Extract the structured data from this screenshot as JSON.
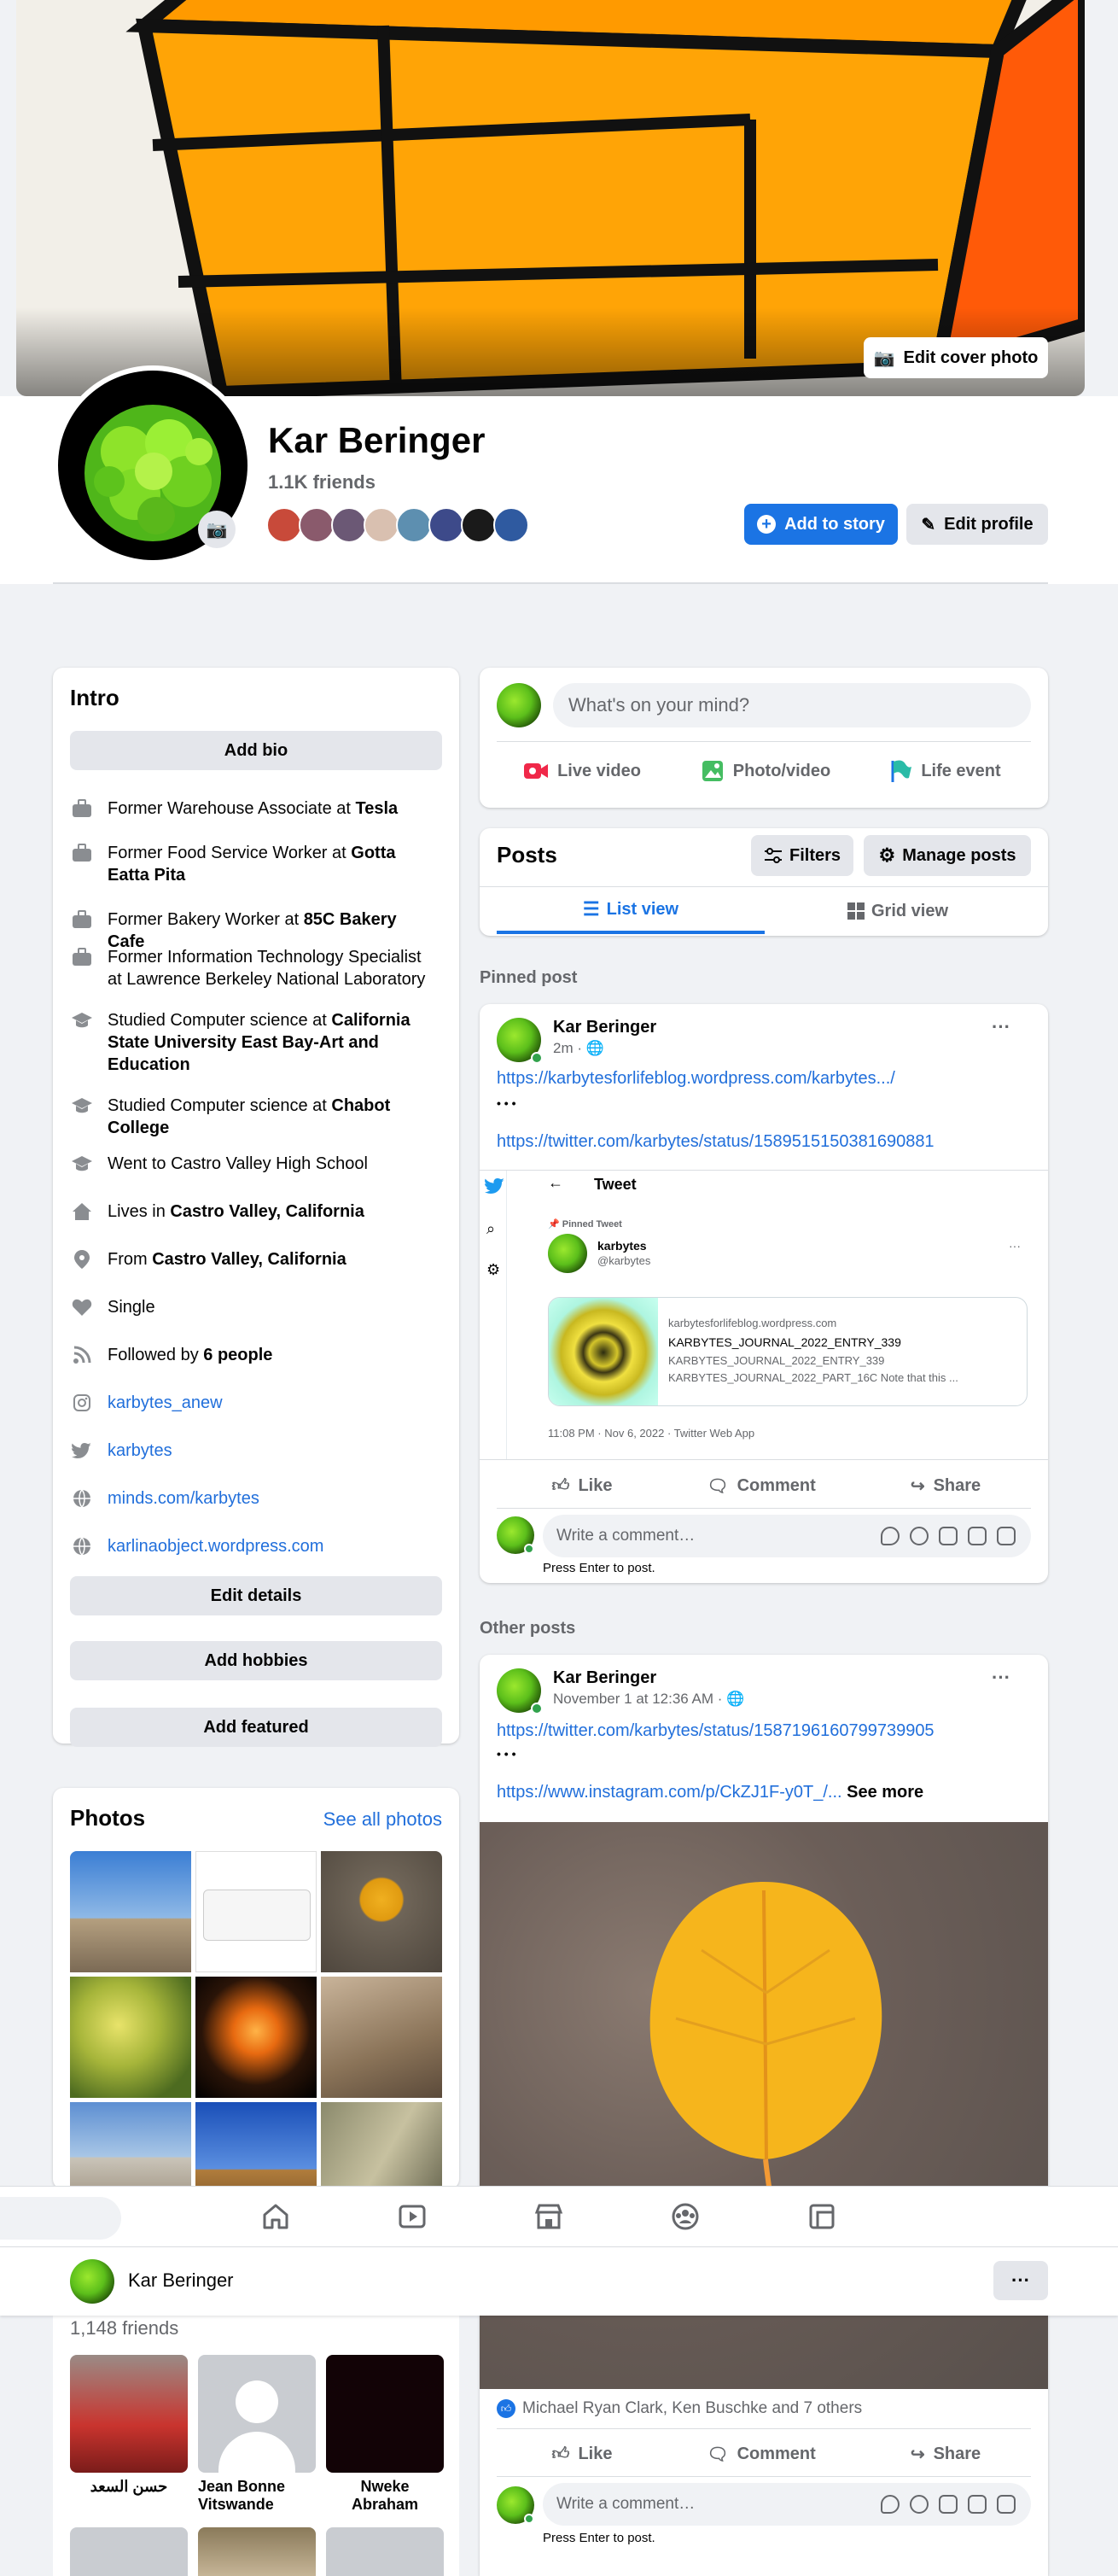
{
  "cover": {
    "edit_cover_label": "Edit cover photo"
  },
  "profile": {
    "name": "Kar Beringer",
    "friends_count": "1.1K friends",
    "add_story_label": "Add to story",
    "edit_profile_label": "Edit profile"
  },
  "intro": {
    "title": "Intro",
    "add_bio_label": "Add bio",
    "items": [
      {
        "icon": "briefcase-icon",
        "prefix": "Former Warehouse Associate at ",
        "bold": "Tesla"
      },
      {
        "icon": "briefcase-icon",
        "prefix": "Former Food Service Worker at ",
        "bold": "Gotta Eatta Pita"
      },
      {
        "icon": "briefcase-icon",
        "prefix": "Former Bakery Worker at ",
        "bold": "85C Bakery Cafe"
      },
      {
        "icon": "briefcase-icon",
        "prefix": "Former Information Technology Specialist at Lawrence Berkeley National Laboratory",
        "bold": ""
      },
      {
        "icon": "graduation-cap-icon",
        "prefix": "Studied Computer science at ",
        "bold": "California State University East Bay-Art and Education"
      },
      {
        "icon": "graduation-cap-icon",
        "prefix": "Studied Computer science at ",
        "bold": "Chabot College"
      },
      {
        "icon": "graduation-cap-icon",
        "prefix": "Went to Castro Valley High School",
        "bold": ""
      },
      {
        "icon": "home-icon",
        "prefix": "Lives in ",
        "bold": "Castro Valley, California"
      },
      {
        "icon": "location-pin-icon",
        "prefix": "From ",
        "bold": "Castro Valley, California"
      },
      {
        "icon": "heart-icon",
        "prefix": "Single",
        "bold": ""
      },
      {
        "icon": "rss-icon",
        "prefix": "Followed by ",
        "bold": "6 people"
      }
    ],
    "links": [
      {
        "icon": "instagram-icon",
        "text": "karbytes_anew"
      },
      {
        "icon": "twitter-icon",
        "text": "karbytes"
      },
      {
        "icon": "globe-icon",
        "text": "minds.com/karbytes"
      },
      {
        "icon": "globe-icon",
        "text": "karlinaobject.wordpress.com"
      }
    ],
    "edit_details_label": "Edit details",
    "add_hobbies_label": "Add hobbies",
    "add_featured_label": "Add featured"
  },
  "photos": {
    "title": "Photos",
    "see_all_label": "See all photos"
  },
  "friends": {
    "count": "1,148 friends",
    "items": [
      {
        "name": "حسن السعد"
      },
      {
        "name": "Jean Bonne Vitswande"
      },
      {
        "name": "Nweke Abraham"
      }
    ]
  },
  "composer": {
    "placeholder": "What's on your mind?",
    "live_label": "Live video",
    "photo_label": "Photo/video",
    "life_label": "Life event"
  },
  "posts_header": {
    "title": "Posts",
    "filters_label": "Filters",
    "manage_label": "Manage posts",
    "list_view_label": "List view",
    "grid_view_label": "Grid view"
  },
  "pinned": {
    "section_label": "Pinned post",
    "author": "Kar Beringer",
    "time": "2m · ",
    "link1": "https://karbytesforlifeblog.wordpress.com/karbytes.../",
    "dots": "• • •",
    "link2": "https://twitter.com/karbytes/status/1589515150381690881",
    "embed": {
      "tweet_title": "Tweet",
      "pinned_label": "Pinned Tweet",
      "handle_name": "karbytes",
      "handle": "@karbytes",
      "card_domain": "karbytesforlifeblog.wordpress.com",
      "card_title": "KARBYTES_JOURNAL_2022_ENTRY_339",
      "card_line2": "KARBYTES_JOURNAL_2022_ENTRY_339",
      "card_line3": "KARBYTES_JOURNAL_2022_PART_16C Note that this ...",
      "timestamp": "11:08 PM · Nov 6, 2022 · Twitter Web App"
    },
    "like_label": "Like",
    "comment_label": "Comment",
    "share_label": "Share",
    "comment_placeholder": "Write a comment…",
    "press_enter": "Press Enter to post."
  },
  "other": {
    "section_label": "Other posts",
    "author": "Kar Beringer",
    "time": "November 1 at 12:36 AM · ",
    "link1": "https://twitter.com/karbytes/status/1587196160799739905",
    "dots": "• • •",
    "link2": "https://www.instagram.com/p/CkZJ1F-y0T_/...",
    "see_more": " See more",
    "reactions": "Michael Ryan Clark, Ken Buschke and 7 others",
    "like_label": "Like",
    "comment_label": "Comment",
    "share_label": "Share",
    "comment_placeholder": "Write a comment…",
    "press_enter": "Press Enter to post."
  },
  "sticky_bar": {
    "name": "Kar Beringer",
    "more_label": "···"
  }
}
